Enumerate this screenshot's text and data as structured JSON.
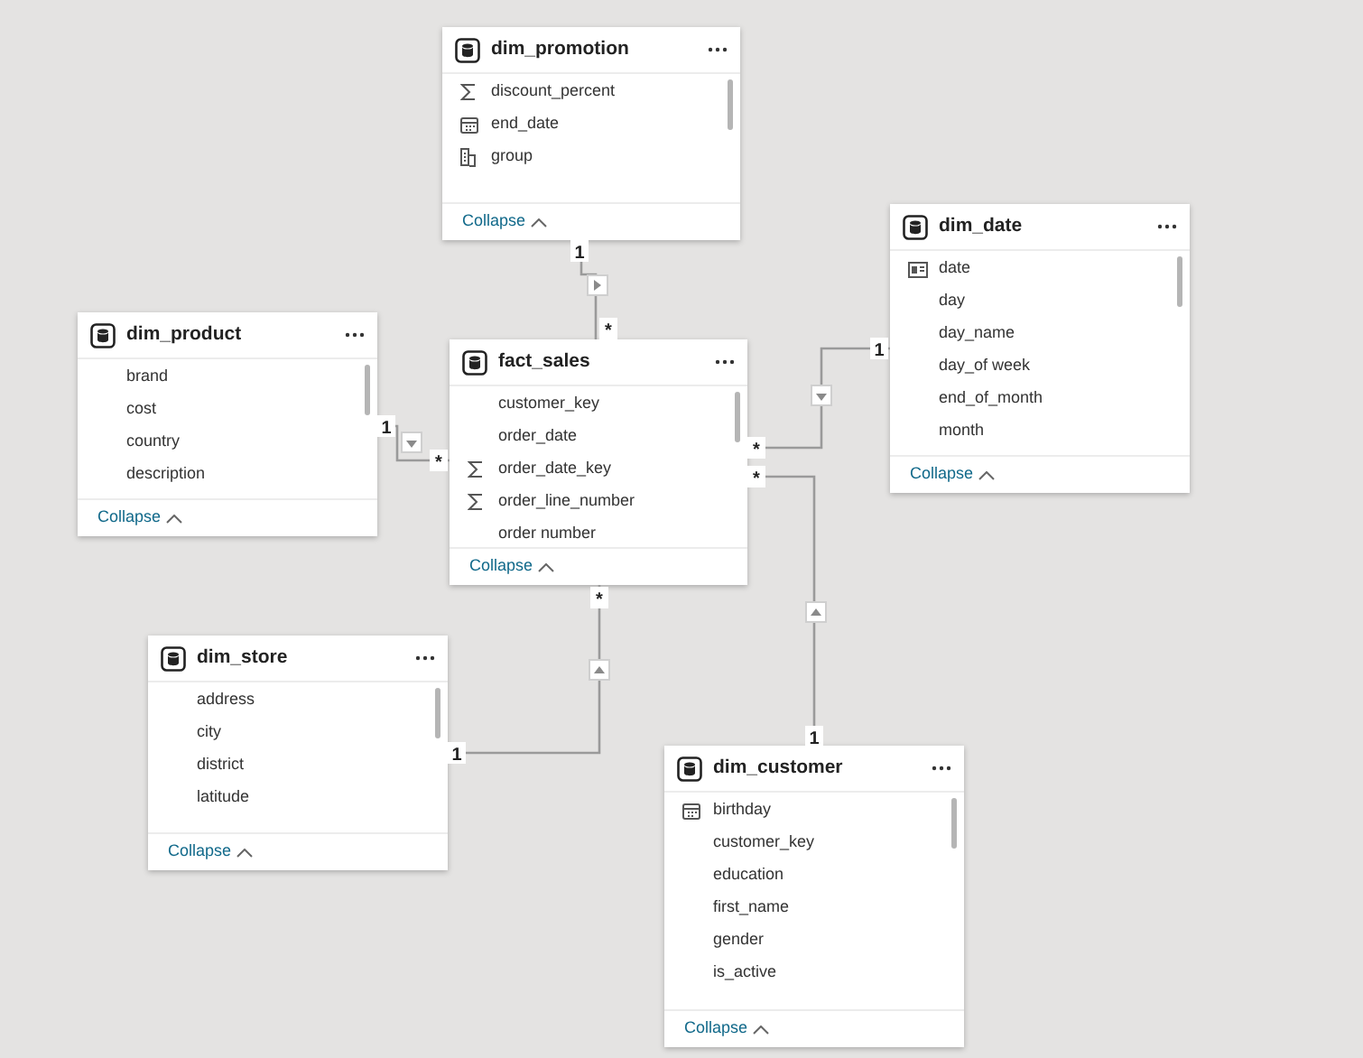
{
  "tables": [
    {
      "name": "dim_promotion",
      "fields": [
        {
          "name": "discount_percent",
          "kind": "sum"
        },
        {
          "name": "end_date",
          "kind": "calendar"
        },
        {
          "name": "group",
          "kind": "hierarchy"
        }
      ],
      "collapse": "Collapse"
    },
    {
      "name": "dim_product",
      "fields": [
        {
          "name": "brand",
          "kind": "plain"
        },
        {
          "name": "cost",
          "kind": "plain"
        },
        {
          "name": "country",
          "kind": "plain"
        },
        {
          "name": "description",
          "kind": "plain"
        }
      ],
      "collapse": "Collapse"
    },
    {
      "name": "fact_sales",
      "fields": [
        {
          "name": "customer_key",
          "kind": "plain"
        },
        {
          "name": "order_date",
          "kind": "plain"
        },
        {
          "name": "order_date_key",
          "kind": "sum"
        },
        {
          "name": "order_line_number",
          "kind": "sum"
        },
        {
          "name": "order number",
          "kind": "plain"
        }
      ],
      "collapse": "Collapse"
    },
    {
      "name": "dim_date",
      "fields": [
        {
          "name": "date",
          "kind": "id"
        },
        {
          "name": "day",
          "kind": "plain"
        },
        {
          "name": "day_name",
          "kind": "plain"
        },
        {
          "name": "day_of week",
          "kind": "plain"
        },
        {
          "name": "end_of_month",
          "kind": "plain"
        },
        {
          "name": "month",
          "kind": "plain"
        }
      ],
      "collapse": "Collapse"
    },
    {
      "name": "dim_store",
      "fields": [
        {
          "name": "address",
          "kind": "plain"
        },
        {
          "name": "city",
          "kind": "plain"
        },
        {
          "name": "district",
          "kind": "plain"
        },
        {
          "name": "latitude",
          "kind": "plain"
        }
      ],
      "collapse": "Collapse"
    },
    {
      "name": "dim_customer",
      "fields": [
        {
          "name": "birthday",
          "kind": "calendar"
        },
        {
          "name": "customer_key",
          "kind": "plain"
        },
        {
          "name": "education",
          "kind": "plain"
        },
        {
          "name": "first_name",
          "kind": "plain"
        },
        {
          "name": "gender",
          "kind": "plain"
        },
        {
          "name": "is_active",
          "kind": "plain"
        }
      ],
      "collapse": "Collapse"
    }
  ],
  "relationships": [
    {
      "one_label": "1",
      "many_label": "*"
    },
    {
      "one_label": "1",
      "many_label": "*"
    },
    {
      "one_label": "1",
      "many_label": "*"
    },
    {
      "one_label": "1",
      "many_label": "*"
    },
    {
      "one_label": "1",
      "many_label": "*"
    }
  ]
}
